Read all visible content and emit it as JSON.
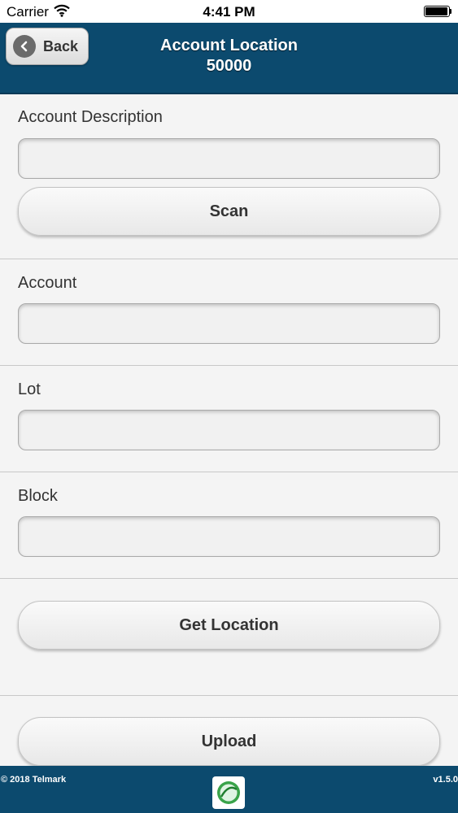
{
  "status_bar": {
    "carrier": "Carrier",
    "time": "4:41 PM"
  },
  "nav": {
    "back_label": "Back",
    "title": "Account Location",
    "subtitle": "50000"
  },
  "form": {
    "account_description": {
      "label": "Account Description",
      "value": ""
    },
    "scan_label": "Scan",
    "account": {
      "label": "Account",
      "value": ""
    },
    "lot": {
      "label": "Lot",
      "value": ""
    },
    "block": {
      "label": "Block",
      "value": ""
    },
    "get_location_label": "Get Location",
    "upload_label": "Upload"
  },
  "footer": {
    "copyright": "© 2018 Telmark",
    "version": "v1.5.0"
  },
  "icons": {
    "back": "chevron-left-icon",
    "wifi": "wifi-icon",
    "battery": "battery-icon",
    "logo": "telmark-logo-icon"
  },
  "colors": {
    "header": "#0c4a6e",
    "background": "#f4f4f4"
  }
}
